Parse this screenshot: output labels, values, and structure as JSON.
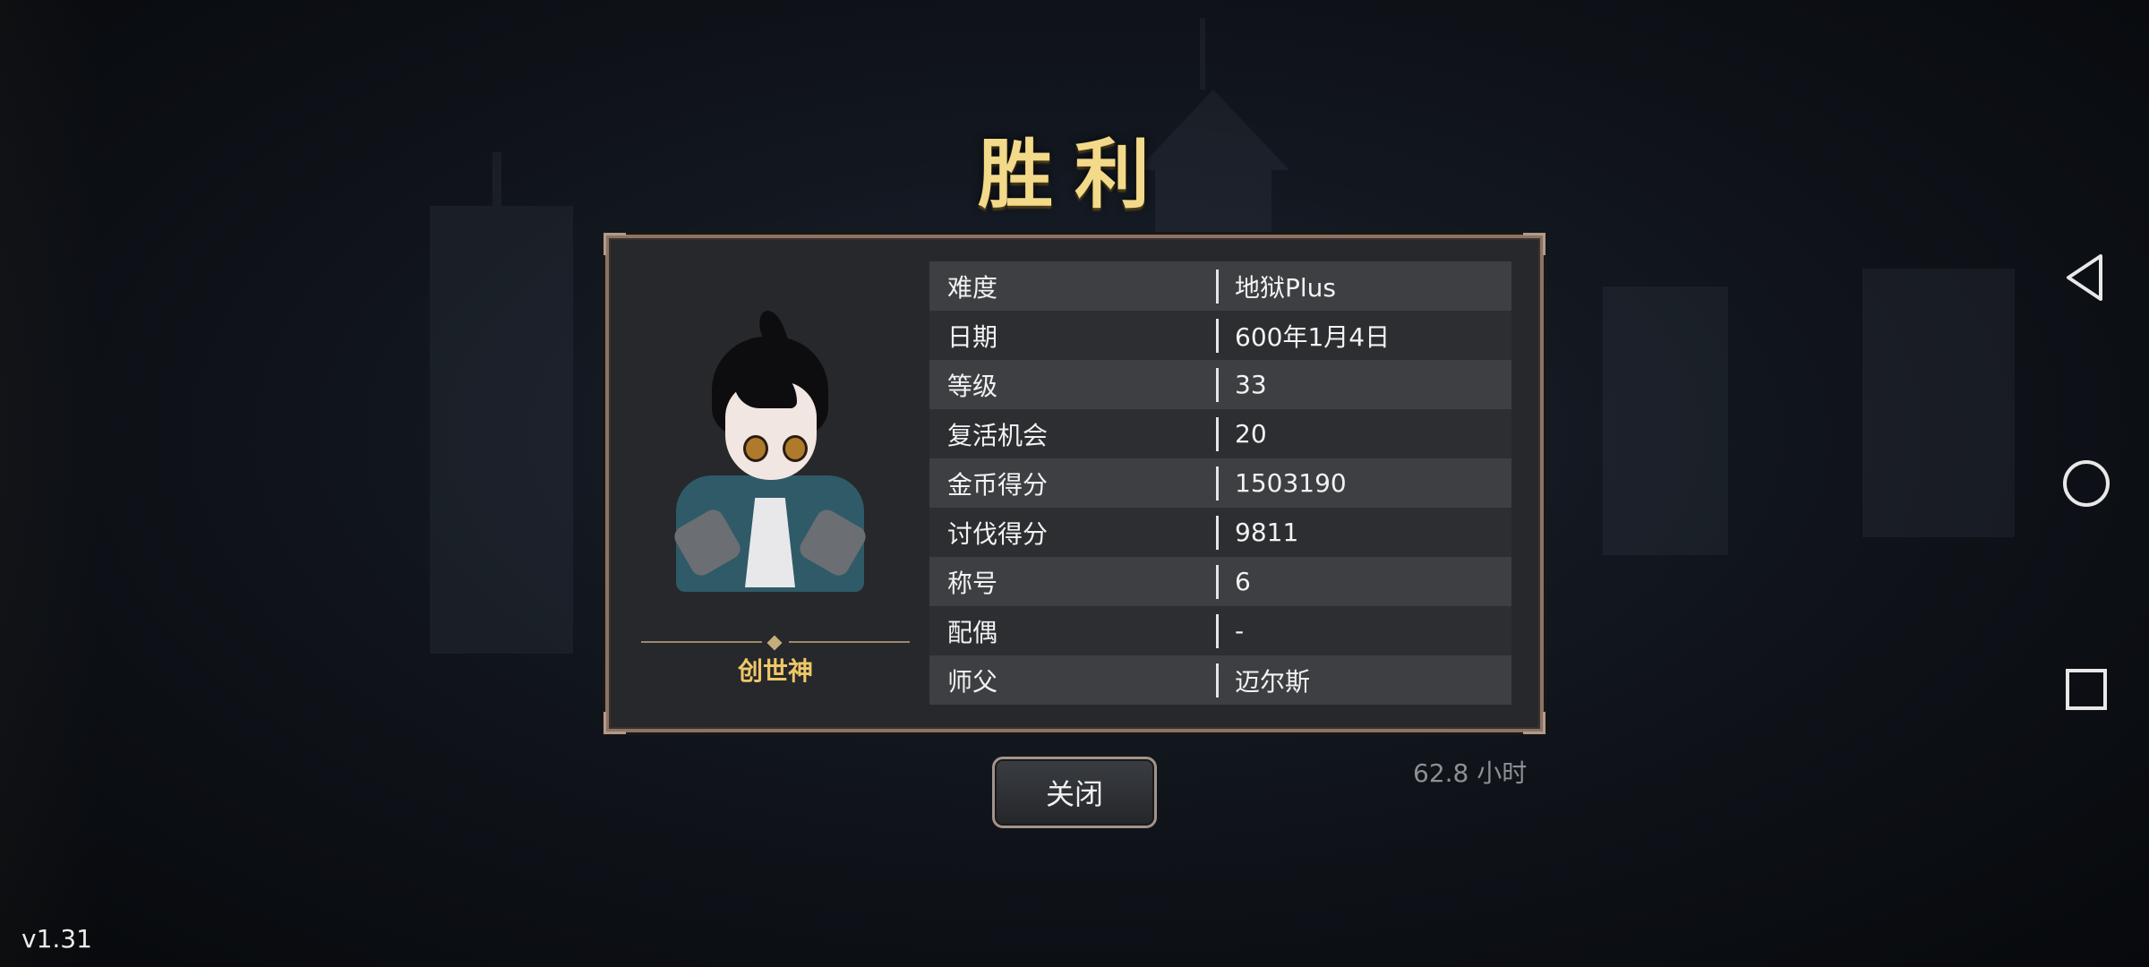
{
  "title": "胜利",
  "character": {
    "name": "创世神"
  },
  "stats": [
    {
      "label": "难度",
      "value": "地狱Plus"
    },
    {
      "label": "日期",
      "value": "600年1月4日"
    },
    {
      "label": "等级",
      "value": "33"
    },
    {
      "label": "复活机会",
      "value": "20"
    },
    {
      "label": "金币得分",
      "value": "1503190"
    },
    {
      "label": "讨伐得分",
      "value": "9811"
    },
    {
      "label": "称号",
      "value": "6"
    },
    {
      "label": "配偶",
      "value": "-"
    },
    {
      "label": "师父",
      "value": "迈尔斯"
    }
  ],
  "close_label": "关闭",
  "playtime": "62.8 小时",
  "version": "v1.31",
  "nav": {
    "back": "back-icon",
    "home": "home-icon",
    "recents": "recents-icon"
  },
  "colors": {
    "title": "#f3d98a",
    "name": "#efc768",
    "panel_border": "#8a7467"
  }
}
